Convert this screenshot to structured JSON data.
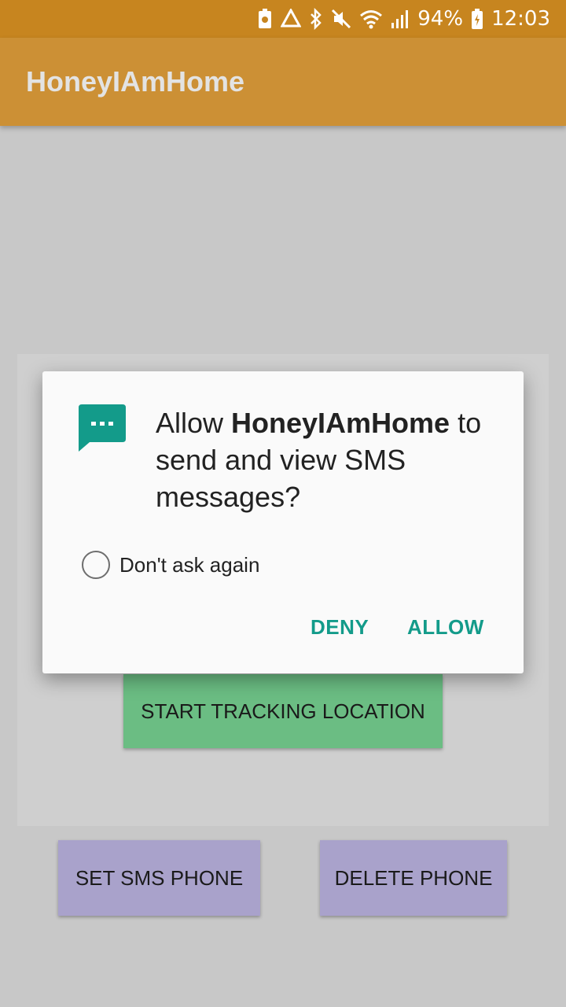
{
  "status_bar": {
    "battery_percent": "94%",
    "time": "12:03",
    "icons": [
      "battery-saver-icon",
      "recycle-icon",
      "bluetooth-icon",
      "mute-icon",
      "wifi-icon",
      "signal-icon",
      "battery-charging-icon"
    ]
  },
  "app_bar": {
    "title": "HoneyIAmHome"
  },
  "buttons": {
    "start_tracking": "START TRACKING LOCATION",
    "set_sms_phone": "SET SMS PHONE",
    "delete_phone": "DELETE PHONE"
  },
  "dialog": {
    "prefix": "Allow ",
    "app_name": "HoneyIAmHome",
    "suffix": " to send and view SMS messages?",
    "dont_ask_label": "Don't ask again",
    "deny_label": "DENY",
    "allow_label": "ALLOW",
    "icon": "sms-icon"
  },
  "colors": {
    "status_bar": "#c7851f",
    "app_bar": "#cc9035",
    "accent": "#139b8a",
    "start_button": "#6bbd83",
    "secondary_button": "#a9a2cb"
  }
}
